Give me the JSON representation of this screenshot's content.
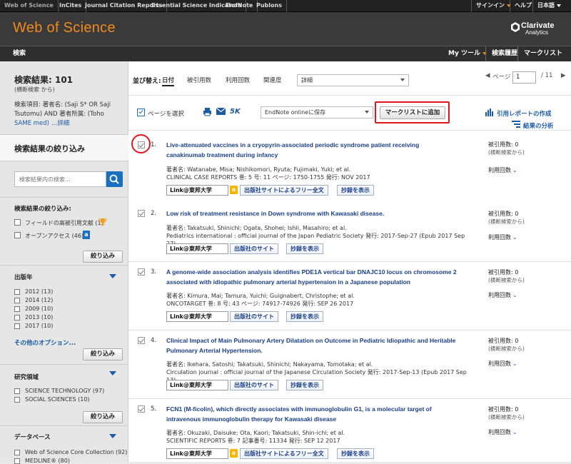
{
  "topbar": {
    "tabs": [
      "Web of Science",
      "InCites",
      "Journal Citation Reports",
      "Essential Science Indicators",
      "EndNote",
      "Publons"
    ],
    "signin": "サインイン",
    "help": "ヘルプ",
    "language": "日本語"
  },
  "header": {
    "logo": "Web of Science",
    "brand_name": "Clarivate",
    "brand_sub": "Analytics"
  },
  "navbar": {
    "search": "検索",
    "mytools": "My ツール",
    "history": "検索履歴",
    "marked": "マークリスト"
  },
  "sidebar": {
    "result_count": "検索結果: 101",
    "result_sub": "(横断検索 から)",
    "query_lines": [
      "検索項目: 著者名: (Saji S* OR Saji",
      "Tsutomu) AND 著者所属: (Toho",
      "SAME med) …詳細"
    ],
    "refine_header": "検索結果の絞り込み",
    "search_placeholder": "検索結果内の検索...",
    "refine_label": "検索結果の絞り込み:",
    "filters": [
      {
        "label": "フィールドの高被引用文献 (1)"
      },
      {
        "label": "オープンアクセス (46)"
      }
    ],
    "refine_button": "絞り込み",
    "pubyear_title": "出版年",
    "pubyears": [
      "2012 (13)",
      "2014 (12)",
      "2009 (10)",
      "2013 (10)",
      "2017 (10)"
    ],
    "more_options": "その他のオプション...",
    "research_title": "研究領域",
    "research": [
      "SCIENCE TECHNOLOGY (97)",
      "SOCIAL SCIENCES (10)"
    ],
    "database_title": "データベース",
    "databases": [
      "Web of Science Core Collection (92)",
      "MEDLINE® (80)"
    ]
  },
  "sortbar": {
    "label": "並び替え:",
    "options": [
      "日付",
      "被引用数",
      "利用回数",
      "関連度"
    ],
    "more": "詳細",
    "page_label": "ページ",
    "page_value": "1",
    "page_total": "/ 11"
  },
  "tools": {
    "select_page": "ページを選択",
    "five_k": "5K",
    "endnote": "EndNote onlineに保存",
    "add_marked": "マークリストに追加",
    "citation_report": "引用レポートの作成",
    "analyze": "結果の分析"
  },
  "records": [
    {
      "num": "1.",
      "title": [
        "Live-attenuated vaccines in a cryopyrin-associated periodic syndrome patient receiving",
        "canakinumab treatment during infancy"
      ],
      "authors": "著者名: Watanabe, Misa; Nishikomori, Ryuta; Fujimaki, Yuki; et al.",
      "source": "CLINICAL CASE REPORTS  巻: 5  号: 11  ページ: 1750-1755  発行: NOV 2017",
      "link_label": "Link@東邦大学",
      "publisher_btn": "出版社サイトによるフリー全文",
      "abstract_btn": "抄録を表示",
      "cited": "被引用数: 0",
      "cited_sub": "(横断検索から)",
      "usage": "利用回数"
    },
    {
      "num": "2.",
      "title": [
        "Low risk of treatment resistance in Down syndrome with Kawasaki disease."
      ],
      "authors": "著者名: Takatsuki, Shinichi; Ogata, Shohei; Ishii, Masahiro; et al.",
      "source": "Pediatrics international : official journal of the Japan Pediatric Society     発行: 2017-Sep-27 (Epub 2017 Sep 27)",
      "link_label": "Link@東邦大学",
      "publisher_btn": "出版社のサイト",
      "abstract_btn": "抄録を表示",
      "cited": "被引用数: 0",
      "cited_sub": "(横断検索から)",
      "usage": "利用回数"
    },
    {
      "num": "3.",
      "title": [
        "A genome-wide association analysis identifies PDE1A vertical bar DNAJC10 locus on chromosome 2",
        "associated with idiopathic pulmonary arterial hypertension in a Japanese population"
      ],
      "authors": "著者名: Kimura, Mai; Tamura, Yuichi; Guignabert, Christophe; et al.",
      "source": "ONCOTARGET  巻: 8  号: 43  ページ: 74917-74926  発行: SEP 26 2017",
      "link_label": "Link@東邦大学",
      "publisher_btn": "出版社のサイト",
      "abstract_btn": "抄録を表示",
      "cited": "被引用数: 0",
      "cited_sub": "(横断検索から)",
      "usage": "利用回数"
    },
    {
      "num": "4.",
      "title": [
        "Clinical Impact of Main Pulmonary Artery Dilatation on Outcome in Pediatric Idiopathic and Heritable",
        "Pulmonary Arterial Hypertension."
      ],
      "authors": "著者名: Ikehara, Satoshi; Takatsuki, Shinichi; Nakayama, Tomotaka; et al.",
      "source": "Circulation journal : official journal of the Japanese Circulation Society     発行: 2017-Sep-13 (Epub 2017 Sep 13)",
      "link_label": "Link@東邦大学",
      "publisher_btn": "出版社のサイト",
      "abstract_btn": "抄録を表示",
      "cited": "被引用数: 0",
      "cited_sub": "(横断検索から)",
      "usage": "利用回数"
    },
    {
      "num": "5.",
      "title": [
        "FCN1 (M-ficolin), which directly associates with immunoglobulin G1, is a molecular target of",
        "intravenous immunoglobulin therapy for Kawasaki disease"
      ],
      "authors": "著者名: Okuzaki, Daisuke; Ota, Kaori; Takatsuki, Shin-ichi; et al.",
      "source": "SCIENTIFIC REPORTS  巻: 7  記事番号: 11334  発行: SEP 12 2017",
      "link_label": "Link@東邦大学",
      "publisher_btn": "出版社サイトによるフリー全文",
      "abstract_btn": "抄録を表示",
      "cited": "被引用数: 0",
      "cited_sub": "(横断検索から)",
      "usage": "利用回数"
    }
  ],
  "colors": {
    "accent": "#f08a1c",
    "link": "#1a3f8a",
    "highlight": "#e0151c"
  }
}
